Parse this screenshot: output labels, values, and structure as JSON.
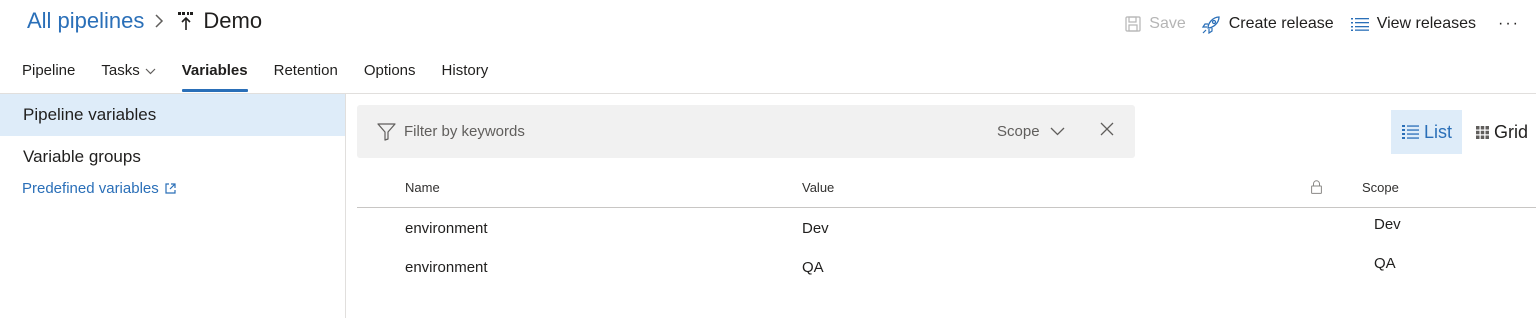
{
  "breadcrumb": {
    "root": "All pipelines",
    "current": "Demo",
    "pipeline_icon": "release-pipeline-icon"
  },
  "actions": {
    "save": "Save",
    "create_release": "Create release",
    "view_releases": "View releases",
    "more": "···"
  },
  "tabs": [
    {
      "label": "Pipeline"
    },
    {
      "label": "Tasks"
    },
    {
      "label": "Variables"
    },
    {
      "label": "Retention"
    },
    {
      "label": "Options"
    },
    {
      "label": "History"
    }
  ],
  "active_tab": "Variables",
  "sidebar": {
    "items": [
      {
        "label": "Pipeline variables"
      },
      {
        "label": "Variable groups"
      }
    ],
    "link": "Predefined variables"
  },
  "filter": {
    "placeholder": "Filter by keywords",
    "scope_label": "Scope"
  },
  "view_toggle": {
    "list": "List",
    "grid": "Grid"
  },
  "table": {
    "columns": {
      "name": "Name",
      "value": "Value",
      "scope": "Scope"
    },
    "rows": [
      {
        "name": "environment",
        "value": "Dev",
        "scope": "Dev"
      },
      {
        "name": "environment",
        "value": "QA",
        "scope": "QA"
      }
    ]
  },
  "colors": {
    "accent": "#2a6fb8",
    "selected_bg": "#deecf9",
    "filter_bg": "#f1f1f1",
    "disabled": "#b5b5b5"
  }
}
